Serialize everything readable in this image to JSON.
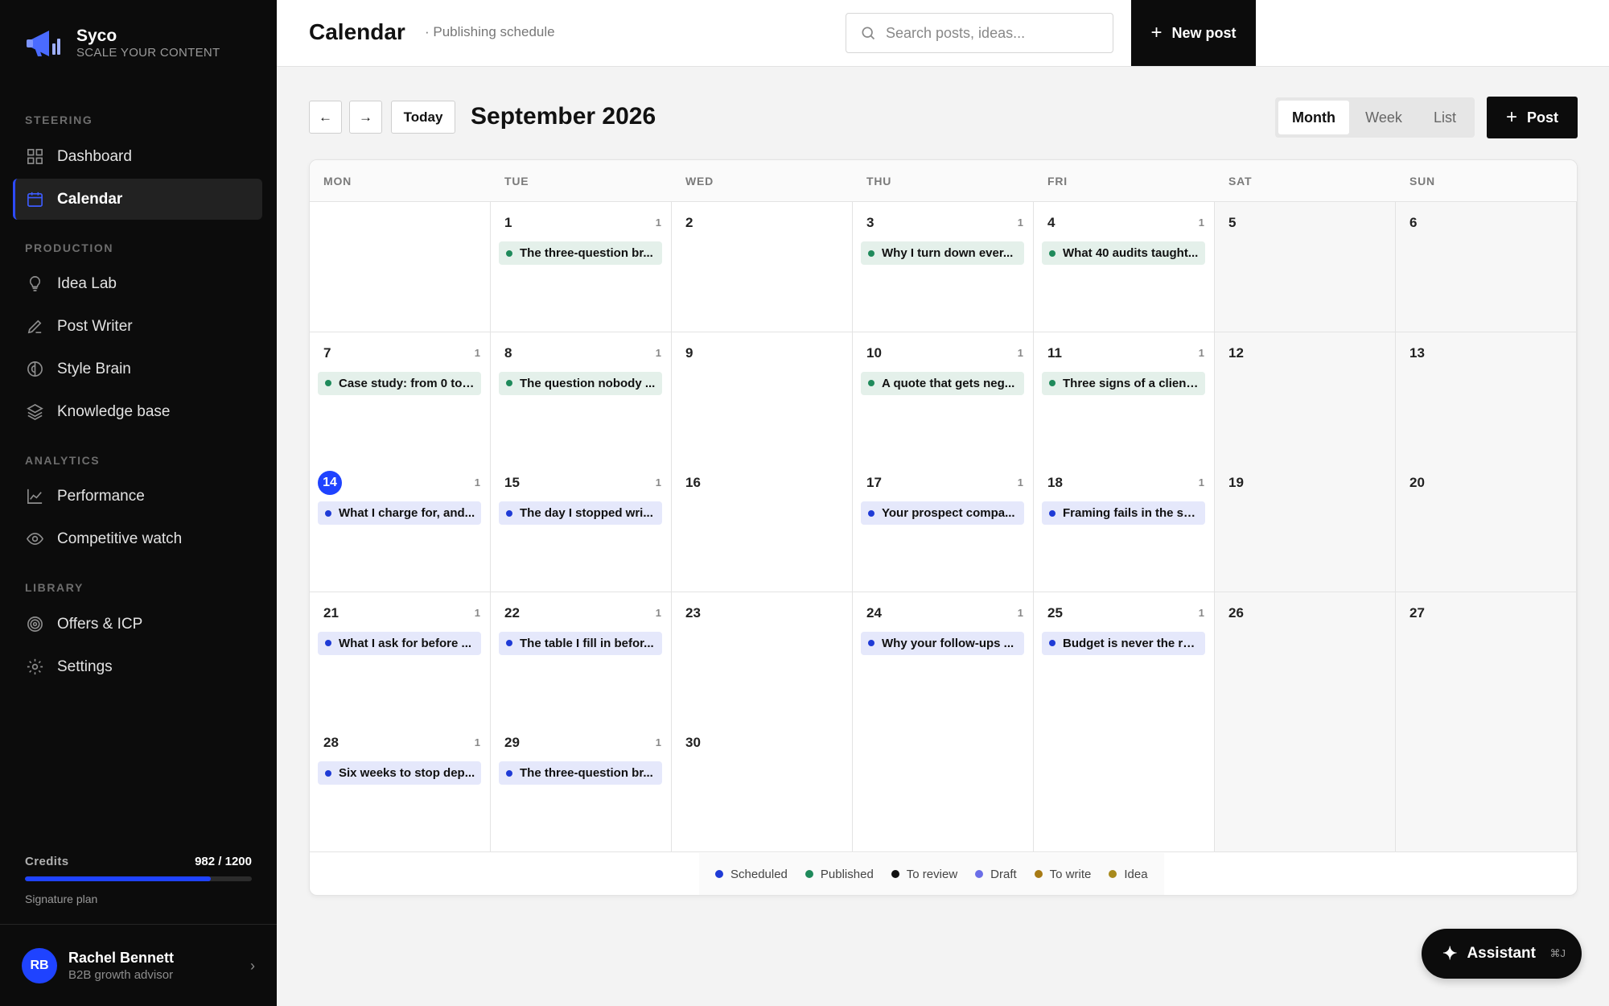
{
  "app": {
    "name": "Syco",
    "tagline": "SCALE YOUR CONTENT"
  },
  "sidebar": {
    "sections": [
      {
        "title": "STEERING",
        "items": [
          {
            "label": "Dashboard",
            "icon": "dashboard-icon",
            "active": false
          },
          {
            "label": "Calendar",
            "icon": "calendar-icon",
            "active": true
          }
        ]
      },
      {
        "title": "PRODUCTION",
        "items": [
          {
            "label": "Idea Lab",
            "icon": "lightbulb-icon",
            "active": false
          },
          {
            "label": "Post Writer",
            "icon": "pen-icon",
            "active": false
          },
          {
            "label": "Style Brain",
            "icon": "brain-icon",
            "active": false
          },
          {
            "label": "Knowledge base",
            "icon": "layers-icon",
            "active": false
          }
        ]
      },
      {
        "title": "ANALYTICS",
        "items": [
          {
            "label": "Performance",
            "icon": "chart-icon",
            "active": false
          },
          {
            "label": "Competitive watch",
            "icon": "eye-icon",
            "active": false
          }
        ]
      },
      {
        "title": "LIBRARY",
        "items": [
          {
            "label": "Offers & ICP",
            "icon": "target-icon",
            "active": false
          },
          {
            "label": "Settings",
            "icon": "gear-icon",
            "active": false
          }
        ]
      }
    ],
    "credits": {
      "label": "Credits",
      "value": "982 / 1200",
      "used": 982,
      "total": 1200,
      "plan": "Signature plan"
    },
    "user": {
      "initials": "RB",
      "name": "Rachel Bennett",
      "role": "B2B growth advisor"
    }
  },
  "topbar": {
    "title": "Calendar",
    "subtitle": "· Publishing schedule",
    "search_placeholder": "Search posts, ideas...",
    "new_post_label": "New post"
  },
  "toolbar": {
    "prev_label": "←",
    "next_label": "→",
    "today_label": "Today",
    "month_title": "September 2026",
    "views": [
      {
        "label": "Month",
        "active": true
      },
      {
        "label": "Week",
        "active": false
      },
      {
        "label": "List",
        "active": false
      }
    ],
    "post_label": "Post"
  },
  "calendar": {
    "weekdays": [
      "MON",
      "TUE",
      "WED",
      "THU",
      "FRI",
      "SAT",
      "SUN"
    ],
    "today": 14,
    "weeks": [
      [
        null,
        {
          "day": "1",
          "count": "1",
          "post": {
            "title": "The three-question br...",
            "status": "published"
          }
        },
        {
          "day": "2"
        },
        {
          "day": "3",
          "count": "1",
          "post": {
            "title": "Why I turn down ever...",
            "status": "published"
          }
        },
        {
          "day": "4",
          "count": "1",
          "post": {
            "title": "What 40 audits taught...",
            "status": "published"
          }
        },
        {
          "day": "5"
        },
        {
          "day": "6"
        }
      ],
      [
        {
          "day": "7",
          "count": "1",
          "post": {
            "title": "Case study: from 0 to ...",
            "status": "published"
          }
        },
        {
          "day": "8",
          "count": "1",
          "post": {
            "title": "The question nobody ...",
            "status": "published"
          }
        },
        {
          "day": "9"
        },
        {
          "day": "10",
          "count": "1",
          "post": {
            "title": "A quote that gets neg...",
            "status": "published"
          }
        },
        {
          "day": "11",
          "count": "1",
          "post": {
            "title": "Three signs of a client...",
            "status": "published"
          }
        },
        {
          "day": "12"
        },
        {
          "day": "13"
        }
      ],
      [
        {
          "day": "14",
          "count": "1",
          "post": {
            "title": "What I charge for, and...",
            "status": "scheduled"
          }
        },
        {
          "day": "15",
          "count": "1",
          "post": {
            "title": "The day I stopped wri...",
            "status": "scheduled"
          }
        },
        {
          "day": "16"
        },
        {
          "day": "17",
          "count": "1",
          "post": {
            "title": "Your prospect compa...",
            "status": "scheduled"
          }
        },
        {
          "day": "18",
          "count": "1",
          "post": {
            "title": "Framing fails in the sa...",
            "status": "scheduled"
          }
        },
        {
          "day": "19"
        },
        {
          "day": "20"
        }
      ],
      [
        {
          "day": "21",
          "count": "1",
          "post": {
            "title": "What I ask for before ...",
            "status": "scheduled"
          }
        },
        {
          "day": "22",
          "count": "1",
          "post": {
            "title": "The table I fill in befor...",
            "status": "scheduled"
          }
        },
        {
          "day": "23"
        },
        {
          "day": "24",
          "count": "1",
          "post": {
            "title": "Why your follow-ups ...",
            "status": "scheduled"
          }
        },
        {
          "day": "25",
          "count": "1",
          "post": {
            "title": "Budget is never the re...",
            "status": "scheduled"
          }
        },
        {
          "day": "26"
        },
        {
          "day": "27"
        }
      ],
      [
        {
          "day": "28",
          "count": "1",
          "post": {
            "title": "Six weeks to stop dep...",
            "status": "scheduled"
          }
        },
        {
          "day": "29",
          "count": "1",
          "post": {
            "title": "The three-question br...",
            "status": "scheduled"
          }
        },
        {
          "day": "30"
        },
        null,
        null,
        null,
        null
      ]
    ]
  },
  "legend": [
    {
      "label": "Scheduled",
      "color": "#1f3bd6"
    },
    {
      "label": "Published",
      "color": "#1f8a5b"
    },
    {
      "label": "To review",
      "color": "#111111"
    },
    {
      "label": "Draft",
      "color": "#6b6ee8"
    },
    {
      "label": "To write",
      "color": "#a77a14"
    },
    {
      "label": "Idea",
      "color": "#a88a1c"
    }
  ],
  "status_colors": {
    "published": "#1f8a5b",
    "scheduled": "#1f3bd6"
  },
  "assistant": {
    "label": "Assistant",
    "shortcut": "⌘J"
  }
}
